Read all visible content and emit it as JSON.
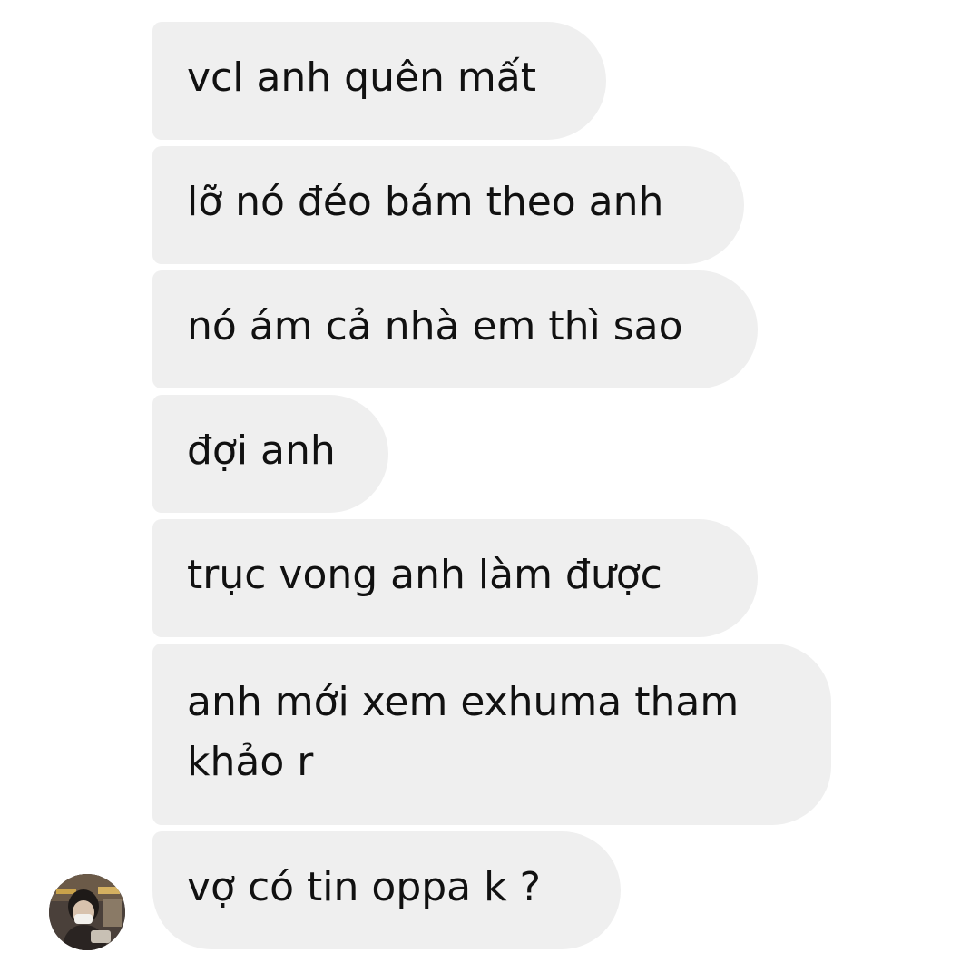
{
  "messages": [
    {
      "text": "vcl anh quên mất"
    },
    {
      "text": "lỡ nó đéo bám theo anh"
    },
    {
      "text": "nó ám cả nhà em thì sao"
    },
    {
      "text": "đợi anh"
    },
    {
      "text": "trục vong anh làm được"
    },
    {
      "text": "anh mới xem exhuma tham khảo r"
    },
    {
      "text": "vợ có tin oppa k ?"
    }
  ],
  "sender": {
    "avatar_icon": "profile-photo-avatar"
  },
  "colors": {
    "bubble_bg": "#efefef",
    "text": "#111111",
    "background": "#ffffff"
  }
}
